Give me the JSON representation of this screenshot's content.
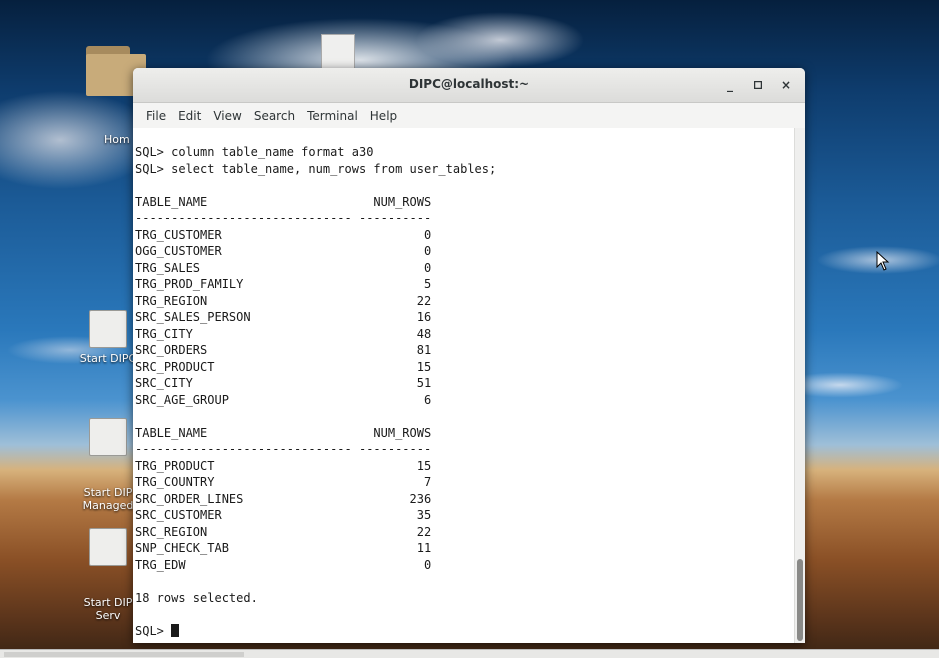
{
  "window": {
    "title": "DIPC@localhost:~",
    "minimize": "_",
    "maximize": "□",
    "close": "×"
  },
  "menu": [
    "File",
    "Edit",
    "View",
    "Search",
    "Terminal",
    "Help"
  ],
  "desktop": {
    "home_label": "Hom",
    "icons": [
      {
        "label": "Start DIPC"
      },
      {
        "label": "Start DIP\nManaged"
      },
      {
        "label": "Start DIP\nServ"
      }
    ]
  },
  "terminal": {
    "lines": [
      "SQL> column table_name format a30",
      "SQL> select table_name, num_rows from user_tables;",
      "",
      "TABLE_NAME                       NUM_ROWS",
      "------------------------------ ----------",
      "TRG_CUSTOMER                            0",
      "OGG_CUSTOMER                            0",
      "TRG_SALES                               0",
      "TRG_PROD_FAMILY                         5",
      "TRG_REGION                             22",
      "SRC_SALES_PERSON                       16",
      "TRG_CITY                               48",
      "SRC_ORDERS                             81",
      "SRC_PRODUCT                            15",
      "SRC_CITY                               51",
      "SRC_AGE_GROUP                           6",
      "",
      "TABLE_NAME                       NUM_ROWS",
      "------------------------------ ----------",
      "TRG_PRODUCT                            15",
      "TRG_COUNTRY                             7",
      "SRC_ORDER_LINES                       236",
      "SRC_CUSTOMER                           35",
      "SRC_REGION                             22",
      "SNP_CHECK_TAB                          11",
      "TRG_EDW                                 0",
      "",
      "18 rows selected.",
      ""
    ],
    "prompt": "SQL> "
  }
}
